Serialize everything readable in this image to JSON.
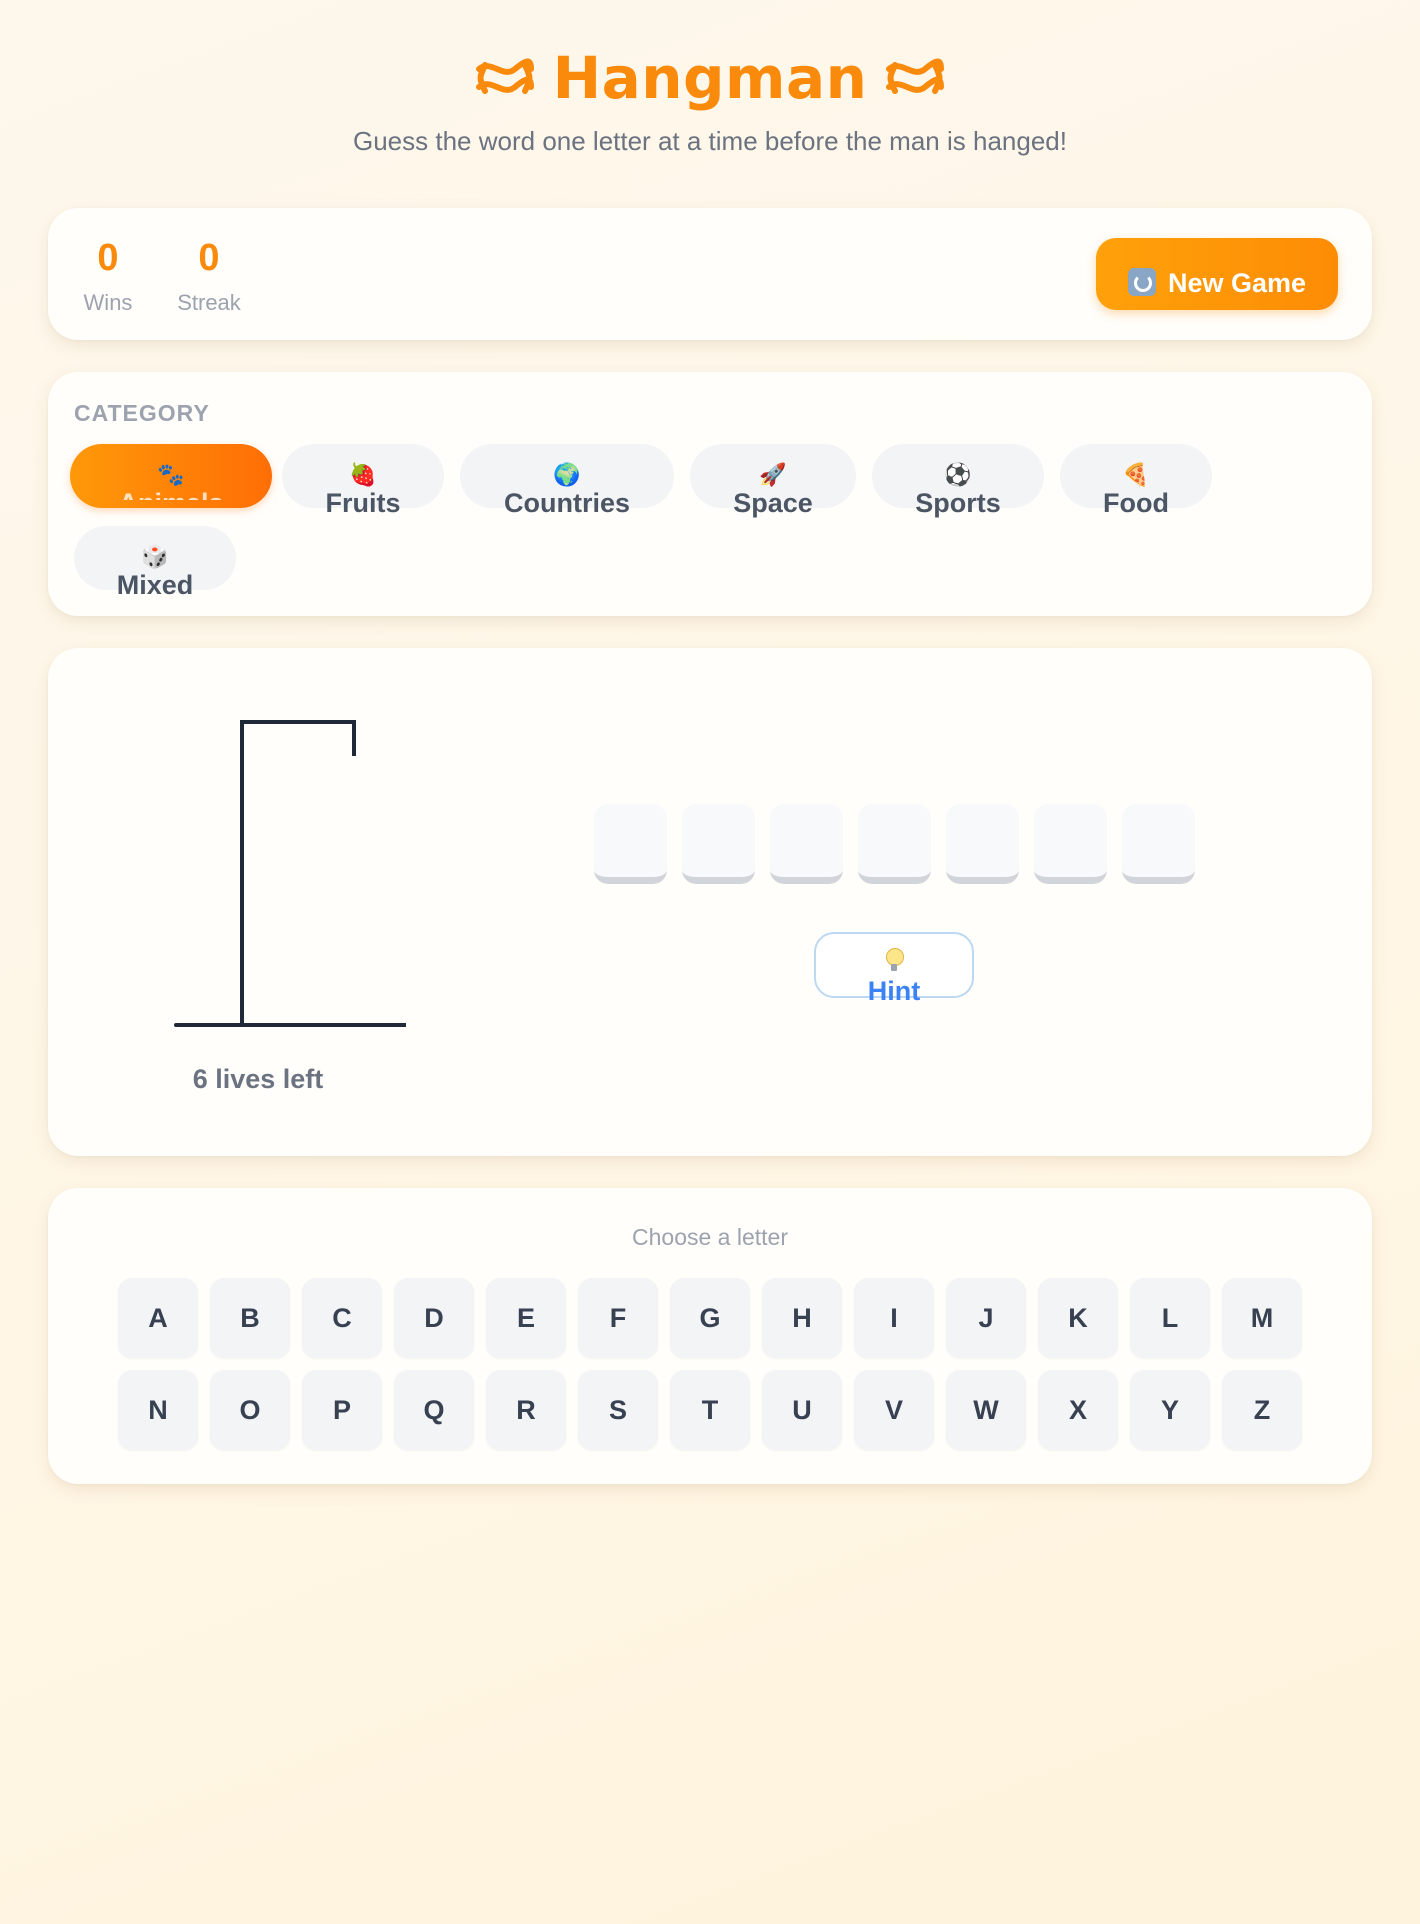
{
  "header": {
    "title": "Hangman",
    "subtitle": "Guess the word one letter at a time before the man is hanged!",
    "title_icon": "knot-icon",
    "accent_color": "#f98a0b"
  },
  "stats": {
    "wins_value": "0",
    "wins_label": "Wins",
    "streak_value": "0",
    "streak_label": "Streak",
    "new_game_label": "New Game",
    "new_game_icon": "refresh-icon"
  },
  "category": {
    "label": "CATEGORY",
    "selected": "Animals",
    "items": [
      {
        "label": "Animals",
        "icon": "paw-icon",
        "emoji": "🐾"
      },
      {
        "label": "Fruits",
        "icon": "strawberry-icon",
        "emoji": "🍓"
      },
      {
        "label": "Countries",
        "icon": "globe-icon",
        "emoji": "🌍"
      },
      {
        "label": "Space",
        "icon": "rocket-icon",
        "emoji": "🚀"
      },
      {
        "label": "Sports",
        "icon": "soccer-ball-icon",
        "emoji": "⚽"
      },
      {
        "label": "Food",
        "icon": "pizza-icon",
        "emoji": "🍕"
      },
      {
        "label": "Mixed",
        "icon": "dice-icon",
        "emoji": "🎲"
      }
    ]
  },
  "game": {
    "lives_text": "6 lives left",
    "lives_remaining": 6,
    "word_length": 7,
    "hint_label": "Hint",
    "hint_icon": "lightbulb-icon"
  },
  "keyboard": {
    "label": "Choose a letter",
    "row1": [
      "A",
      "B",
      "C",
      "D",
      "E",
      "F",
      "G",
      "H",
      "I",
      "J",
      "K",
      "L",
      "M"
    ],
    "row2": [
      "N",
      "O",
      "P",
      "Q",
      "R",
      "S",
      "T",
      "U",
      "V",
      "W",
      "X",
      "Y",
      "Z"
    ]
  }
}
